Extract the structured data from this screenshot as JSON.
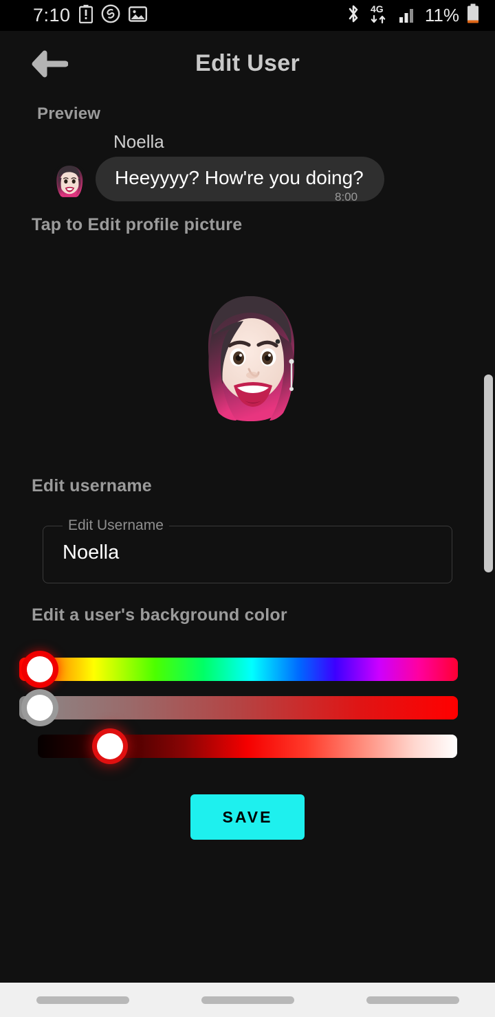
{
  "status_bar": {
    "time": "7:10",
    "battery_percent": "11%",
    "network_type": "4G",
    "left_icons": [
      "battery-alert-icon",
      "shazam-icon",
      "gallery-image-icon"
    ],
    "right_icons": [
      "bluetooth-icon",
      "mobile-data-4g-icon",
      "signal-bars-icon",
      "battery-icon"
    ]
  },
  "header": {
    "title": "Edit User",
    "back_icon": "arrow-left-icon"
  },
  "preview": {
    "section_label": "Preview",
    "sender_name": "Noella",
    "message": "Heeyyyy? How're you doing?",
    "timestamp": "8:00",
    "avatar_alt": "memoji-avatar"
  },
  "profile_picture": {
    "section_label": "Tap to Edit profile picture",
    "avatar_alt": "memoji-avatar-large"
  },
  "username": {
    "section_label": "Edit username",
    "field_label": "Edit Username",
    "value": "Noella",
    "placeholder": "Edit Username"
  },
  "background_color": {
    "section_label": "Edit a user's background color",
    "sliders": [
      {
        "name": "hue",
        "thumb_percent": 3,
        "ring_color": "#f00000"
      },
      {
        "name": "saturation",
        "thumb_percent": 3,
        "ring_color": "#9a9a9a"
      },
      {
        "name": "lightness",
        "thumb_percent": 17,
        "ring_color": "#e01010"
      }
    ]
  },
  "actions": {
    "save_label": "SAVE",
    "save_color": "#1ef0ee"
  },
  "theme": {
    "background": "#111111",
    "status_bar_background": "#000000",
    "bubble_background": "#2f2f2f",
    "text_primary": "#ffffff",
    "text_secondary": "#9b9b9b",
    "nav_bar_background": "#f0f0f0"
  }
}
